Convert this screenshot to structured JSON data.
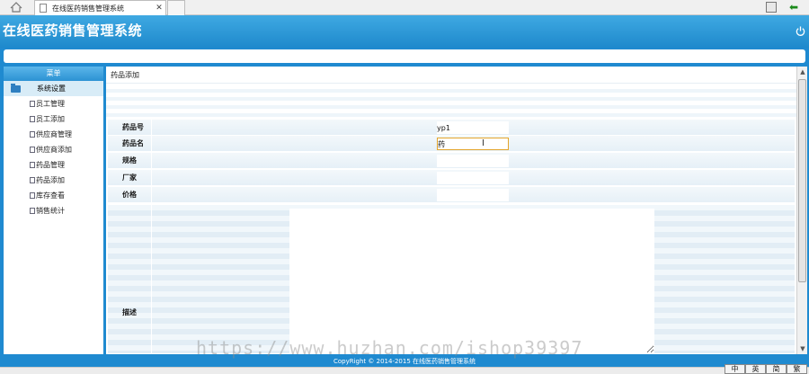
{
  "browser": {
    "tab_title": "在线医药销售管理系统",
    "tab_close": "✕"
  },
  "app": {
    "title": "在线医药销售管理系统"
  },
  "sidebar": {
    "header": "菜单",
    "group": "系统设置",
    "items": [
      {
        "label": "员工管理"
      },
      {
        "label": "员工添加"
      },
      {
        "label": "供应商管理"
      },
      {
        "label": "供应商添加"
      },
      {
        "label": "药品管理"
      },
      {
        "label": "药品添加"
      },
      {
        "label": "库存查看"
      },
      {
        "label": "销售统计"
      }
    ]
  },
  "content": {
    "breadcrumb": "药品添加",
    "form": {
      "drug_no_label": "药品号",
      "drug_no_value": "yp1",
      "drug_name_label": "药品名",
      "drug_name_value": "药",
      "spec_label": "规格",
      "maker_label": "厂家",
      "price_label": "价格",
      "desc_label": "描述"
    }
  },
  "footer": {
    "copyright": "CopyRight © 2014-2015 在线医药销售管理系统"
  },
  "ime": [
    "中",
    "英",
    "简",
    "繁"
  ],
  "watermark": "https://www.huzhan.com/ishop39397",
  "colors": {
    "header_blue": "#1f8ad0",
    "active_field_border": "#e3a52c"
  }
}
